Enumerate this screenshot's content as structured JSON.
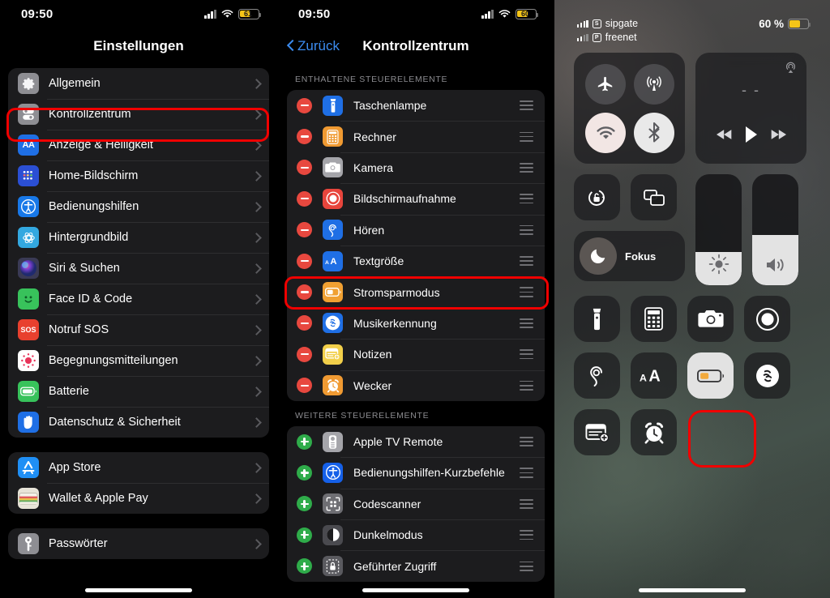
{
  "settings_panel": {
    "status_bar": {
      "time": "09:50",
      "battery_pct": "61"
    },
    "nav_title": "Einstellungen",
    "groups": [
      {
        "items": [
          {
            "label": "Allgemein",
            "icon": "gear-icon",
            "color": "#8e8e93"
          },
          {
            "label": "Kontrollzentrum",
            "icon": "control-center-icon",
            "color": "#8e8e93",
            "highlighted": true
          },
          {
            "label": "Anzeige & Helligkeit",
            "icon": "display-brightness-icon",
            "color": "#1f6fe5"
          },
          {
            "label": "Home-Bildschirm",
            "icon": "home-screen-icon",
            "color": "#2b4fd4"
          },
          {
            "label": "Bedienungshilfen",
            "icon": "accessibility-icon",
            "color": "#1878e8"
          },
          {
            "label": "Hintergrundbild",
            "icon": "wallpaper-icon",
            "color": "#33a8e0"
          },
          {
            "label": "Siri & Suchen",
            "icon": "siri-icon",
            "color": "#3a3a55"
          },
          {
            "label": "Face ID & Code",
            "icon": "face-id-icon",
            "color": "#38c25b"
          },
          {
            "label": "Notruf SOS",
            "icon": "sos-icon",
            "color": "#e8402e"
          },
          {
            "label": "Begegnungsmitteilungen",
            "icon": "exposure-notification-icon",
            "color": "#ffffff"
          },
          {
            "label": "Batterie",
            "icon": "battery-icon",
            "color": "#38c25b"
          },
          {
            "label": "Datenschutz & Sicherheit",
            "icon": "privacy-hand-icon",
            "color": "#1f6fe5"
          }
        ]
      },
      {
        "items": [
          {
            "label": "App Store",
            "icon": "app-store-icon",
            "color": "#1f8ff5"
          },
          {
            "label": "Wallet & Apple Pay",
            "icon": "wallet-icon",
            "color": "#e8e4d8"
          }
        ]
      },
      {
        "items": [
          {
            "label": "Passwörter",
            "icon": "key-icon",
            "color": "#8e8e93"
          }
        ]
      }
    ]
  },
  "control_settings_panel": {
    "status_bar": {
      "time": "09:50",
      "battery_pct": "60"
    },
    "nav_back_label": "Zurück",
    "nav_title": "Kontrollzentrum",
    "sections": [
      {
        "header": "ENTHALTENE STEUERELEMENTE",
        "action": "remove",
        "items": [
          {
            "label": "Taschenlampe",
            "icon": "flashlight-icon",
            "color": "#1f6fe5"
          },
          {
            "label": "Rechner",
            "icon": "calculator-icon",
            "color": "#f09a32"
          },
          {
            "label": "Kamera",
            "icon": "camera-icon",
            "color": "#a5a5aa"
          },
          {
            "label": "Bildschirmaufnahme",
            "icon": "screen-record-icon",
            "color": "#e8453c"
          },
          {
            "label": "Hören",
            "icon": "hearing-icon",
            "color": "#1f6fe5"
          },
          {
            "label": "Textgröße",
            "icon": "text-size-icon",
            "color": "#1f6fe5"
          },
          {
            "label": "Stromsparmodus",
            "icon": "low-power-icon",
            "color": "#f0a032",
            "highlighted": true
          },
          {
            "label": "Musikerkennung",
            "icon": "shazam-icon",
            "color": "#1f6fe5"
          },
          {
            "label": "Notizen",
            "icon": "notes-icon",
            "color": "#f2cf4a"
          },
          {
            "label": "Wecker",
            "icon": "alarm-icon",
            "color": "#f09a32"
          }
        ]
      },
      {
        "header": "WEITERE STEUERELEMENTE",
        "action": "add",
        "items": [
          {
            "label": "Apple TV Remote",
            "icon": "apple-tv-remote-icon",
            "color": "#a5a5aa"
          },
          {
            "label": "Bedienungshilfen-Kurzbefehle",
            "icon": "accessibility-icon",
            "color": "#1560e8"
          },
          {
            "label": "Codescanner",
            "icon": "code-scanner-icon",
            "color": "#6e6e73"
          },
          {
            "label": "Dunkelmodus",
            "icon": "dark-mode-icon",
            "color": "#4a4a4f"
          },
          {
            "label": "Geführter Zugriff",
            "icon": "guided-access-icon",
            "color": "#5a5a5f"
          }
        ]
      }
    ]
  },
  "control_center_panel": {
    "status": {
      "carriers": [
        {
          "sim": "S",
          "name": "sipgate",
          "bars": 4
        },
        {
          "sim": "P",
          "name": "freenet",
          "bars": 2
        }
      ],
      "battery_pct_label": "60 %",
      "battery_level": 60,
      "battery_color": "#f5c518"
    },
    "tiles": {
      "connectivity": [
        {
          "name": "airplane-mode",
          "state": "off"
        },
        {
          "name": "cellular-data",
          "state": "off"
        },
        {
          "name": "wifi",
          "state": "on"
        },
        {
          "name": "bluetooth",
          "state": "on"
        }
      ],
      "media": {
        "title": "- -",
        "play_state": "paused"
      },
      "rotation_lock": {
        "name": "rotation-lock",
        "state": "off"
      },
      "screen_mirroring": {
        "name": "screen-mirroring",
        "state": "off"
      },
      "focus": {
        "label": "Fokus",
        "state": "off"
      },
      "brightness": {
        "name": "brightness-slider",
        "value": 30
      },
      "volume": {
        "name": "volume-slider",
        "value": 45
      },
      "shortcuts_row1": [
        {
          "name": "flashlight",
          "state": "off"
        },
        {
          "name": "calculator",
          "state": "off"
        },
        {
          "name": "camera",
          "state": "off"
        },
        {
          "name": "screen-record",
          "state": "off"
        }
      ],
      "shortcuts_row2": [
        {
          "name": "hearing",
          "state": "off"
        },
        {
          "name": "text-size",
          "state": "off"
        },
        {
          "name": "low-power-mode",
          "state": "on",
          "highlighted": true
        },
        {
          "name": "music-recognition",
          "state": "off"
        }
      ],
      "shortcuts_row3": [
        {
          "name": "quick-note",
          "state": "off"
        },
        {
          "name": "alarm",
          "state": "off"
        }
      ]
    }
  },
  "annotation": {
    "color": "#f00000"
  }
}
